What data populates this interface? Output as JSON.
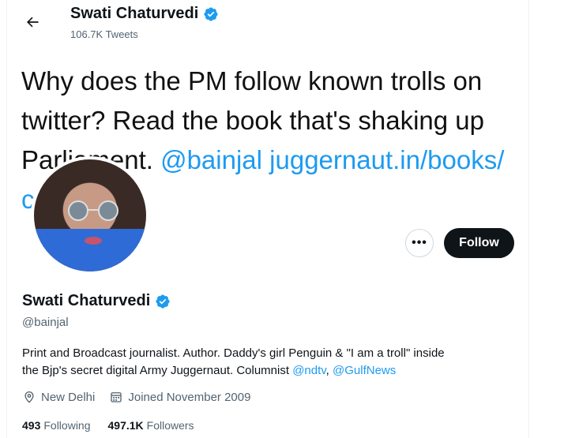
{
  "header": {
    "name": "Swati Chaturvedi",
    "tweets_count": "106.7K Tweets"
  },
  "banner": {
    "line1": "Why does the PM follow known trolls on",
    "line2": "twitter? Read the book that's shaking up",
    "line3_text": "Parliament. ",
    "line3_link": "@bainjal juggernaut.in/books/",
    "line4_link": "c…7…"
  },
  "actions": {
    "more_label": "•••",
    "follow_label": "Follow"
  },
  "profile": {
    "name": "Swati Chaturvedi",
    "handle": "@bainjal",
    "bio_line1": "Print and Broadcast journalist. Author. Daddy's girl Penguin & \"I am a troll\" inside",
    "bio_line2_text": "the Bjp's secret digital Army Juggernaut. Columnist ",
    "mention1": "@ndtv",
    "bio_sep": ", ",
    "mention2": "@GulfNews",
    "location": "New Delhi",
    "joined": "Joined November 2009",
    "following_count": "493",
    "following_label": "Following",
    "followers_count": "497.1K",
    "followers_label": "Followers"
  },
  "icons": {
    "back": "back-arrow-icon",
    "verified": "verified-badge-icon",
    "location": "location-pin-icon",
    "calendar": "calendar-icon"
  },
  "colors": {
    "accent": "#1d9bf0",
    "text": "#0f1419",
    "secondary": "#536471"
  }
}
